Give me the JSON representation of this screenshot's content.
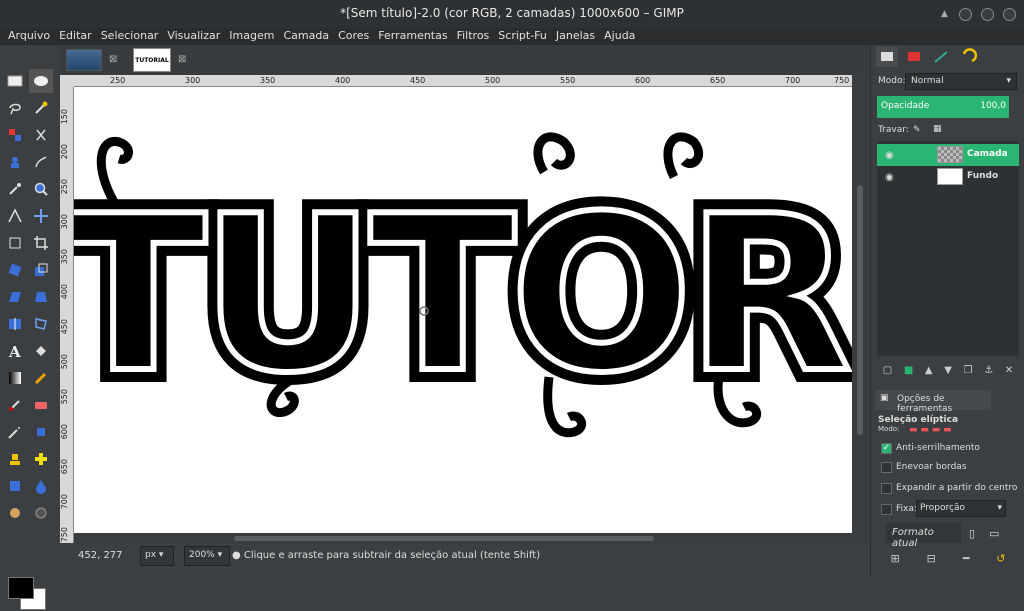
{
  "window": {
    "title": "*[Sem título]-2.0 (cor RGB, 2 camadas) 1000x600 – GIMP"
  },
  "menu": [
    "Arquivo",
    "Editar",
    "Selecionar",
    "Visualizar",
    "Imagem",
    "Camada",
    "Cores",
    "Ferramentas",
    "Filtros",
    "Script-Fu",
    "Janelas",
    "Ajuda"
  ],
  "image_tabs": {
    "active_thumb_text": "TUTORIAL"
  },
  "rulers": {
    "top": [
      "250",
      "300",
      "350",
      "400",
      "450",
      "500",
      "550",
      "600",
      "650",
      "700",
      "750"
    ],
    "left": [
      "150",
      "200",
      "250",
      "300",
      "350",
      "400",
      "450",
      "500",
      "550",
      "600",
      "650",
      "700",
      "750"
    ]
  },
  "canvas": {
    "artwork_text": "TUTORIA"
  },
  "statusbar": {
    "coords": "452, 277",
    "unit": "px",
    "zoom": "200%",
    "message": "Clique e arraste para subtrair da seleção atual (tente Shift)"
  },
  "layers_panel": {
    "mode_label": "Modo:",
    "mode_value": "Normal",
    "opacity_label": "Opacidade",
    "opacity_value": "100,0",
    "lock_label": "Travar:",
    "layers": [
      {
        "name": "Camada",
        "selected": true
      },
      {
        "name": "Fundo",
        "selected": false
      }
    ]
  },
  "tool_options": {
    "tab_label": "Opções de ferramentas",
    "tool_name": "Seleção elíptica",
    "mode_label": "Modo:",
    "antialias_label": "Anti-serrilhamento",
    "antialias_checked": true,
    "feather_label": "Enevoar bordas",
    "expand_label": "Expandir a partir do centro",
    "fixed_label": "Fixa:",
    "fixed_value": "Proporção",
    "current_format": "Formato atual"
  },
  "colors": {
    "accent": "#2bb573",
    "foreground": "#000000",
    "background": "#ffffff"
  }
}
